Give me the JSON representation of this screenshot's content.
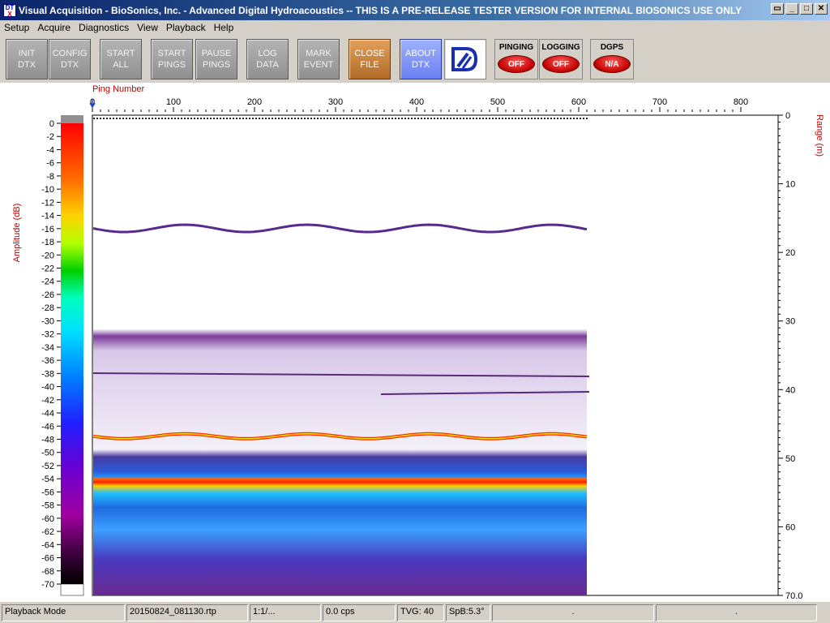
{
  "window": {
    "title": "Visual Acquisition  -  BioSonics, Inc.  -  Advanced Digital Hydroacoustics  -- THIS IS A PRE-RELEASE TESTER VERSION FOR INTERNAL BIOSONICS USE ONLY",
    "icon_top": "DT",
    "icon_bottom": "X"
  },
  "menu": [
    "Setup",
    "Acquire",
    "Diagnostics",
    "View",
    "Playback",
    "Help"
  ],
  "toolbar": {
    "buttons": [
      {
        "line1": "INIT",
        "line2": "DTX"
      },
      {
        "line1": "CONFIG",
        "line2": "DTX"
      },
      {
        "line1": "START",
        "line2": "ALL"
      },
      {
        "line1": "START",
        "line2": "PINGS"
      },
      {
        "line1": "PAUSE",
        "line2": "PINGS"
      },
      {
        "line1": "LOG",
        "line2": "DATA"
      },
      {
        "line1": "MARK",
        "line2": "EVENT"
      },
      {
        "line1": "CLOSE",
        "line2": "FILE"
      },
      {
        "line1": "ABOUT",
        "line2": "DTX"
      }
    ],
    "indicators": [
      {
        "label": "PINGING",
        "state": "OFF"
      },
      {
        "label": "LOGGING",
        "state": "OFF"
      },
      {
        "label": "DGPS",
        "state": "N/A"
      }
    ]
  },
  "echogram": {
    "ping_axis_label": "Ping Number",
    "ping_ticks": [
      "0",
      "100",
      "200",
      "300",
      "400",
      "500",
      "600",
      "700",
      "800"
    ],
    "range_axis_label": "Range (m)",
    "range_ticks": [
      "0",
      "10",
      "20",
      "30",
      "40",
      "50",
      "60",
      "70.0"
    ],
    "amplitude_label": "Amplitude (dB)",
    "amplitude_ticks": [
      "0",
      "-2",
      "-4",
      "-6",
      "-8",
      "-10",
      "-12",
      "-14",
      "-16",
      "-18",
      "-20",
      "-22",
      "-24",
      "-26",
      "-28",
      "-30",
      "-32",
      "-34",
      "-36",
      "-38",
      "-40",
      "-42",
      "-44",
      "-46",
      "-48",
      "-50",
      "-52",
      "-54",
      "-56",
      "-58",
      "-60",
      "-62",
      "-64",
      "-66",
      "-68",
      "-70"
    ],
    "pings_recorded": 610,
    "bottom_depth_m": 46.8,
    "surface_layer_depth_m": 16.5
  },
  "status": {
    "mode": "Playback Mode",
    "file": "20150824_081130.rtp",
    "ratio": "1:1/...",
    "rate": "0.0 cps",
    "tvg": "TVG: 40",
    "spb": "SpB:5.3°",
    "field7": ".",
    "field8": "."
  }
}
